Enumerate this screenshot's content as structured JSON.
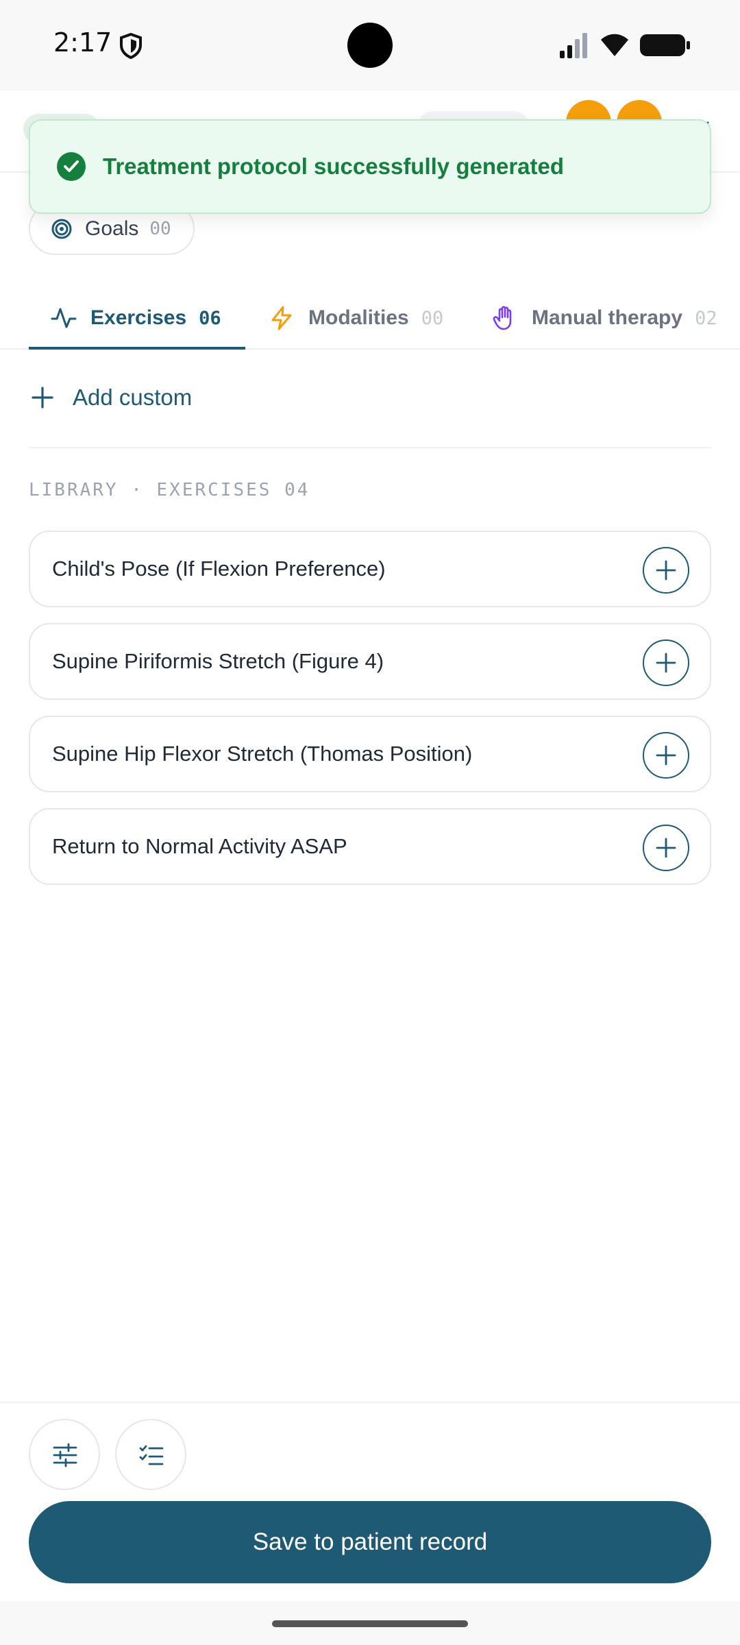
{
  "status_bar": {
    "time": "2:17",
    "icons": [
      "shield-icon",
      "signal-icon",
      "wifi-icon",
      "battery-icon"
    ]
  },
  "toast": {
    "message": "Treatment protocol successfully generated",
    "icon": "check-circle-icon",
    "color": "#15803d",
    "background": "#eafaf0"
  },
  "goals": {
    "label": "Goals",
    "count": "00",
    "icon": "target-icon"
  },
  "tabs": [
    {
      "label": "Exercises",
      "count": "06",
      "icon": "activity-icon",
      "active": true
    },
    {
      "label": "Modalities",
      "count": "00",
      "icon": "lightning-icon",
      "active": false
    },
    {
      "label": "Manual therapy",
      "count": "02",
      "icon": "hand-icon",
      "active": false
    }
  ],
  "add_custom": {
    "label": "Add custom",
    "icon": "plus-icon"
  },
  "library": {
    "header": "LIBRARY · EXERCISES 04",
    "items": [
      {
        "label": "Child's Pose (If Flexion Preference)"
      },
      {
        "label": "Supine Piriformis Stretch (Figure 4)"
      },
      {
        "label": "Supine Hip Flexor Stretch (Thomas Position)"
      },
      {
        "label": "Return to Normal Activity ASAP"
      }
    ]
  },
  "bottom": {
    "filter_icon": "sliders-icon",
    "checklist_icon": "checklist-icon",
    "save_label": "Save to patient record"
  },
  "colors": {
    "primary": "#1e5a73",
    "success": "#15803d",
    "warning": "#f59e0b",
    "accent_purple": "#7c3aed"
  }
}
